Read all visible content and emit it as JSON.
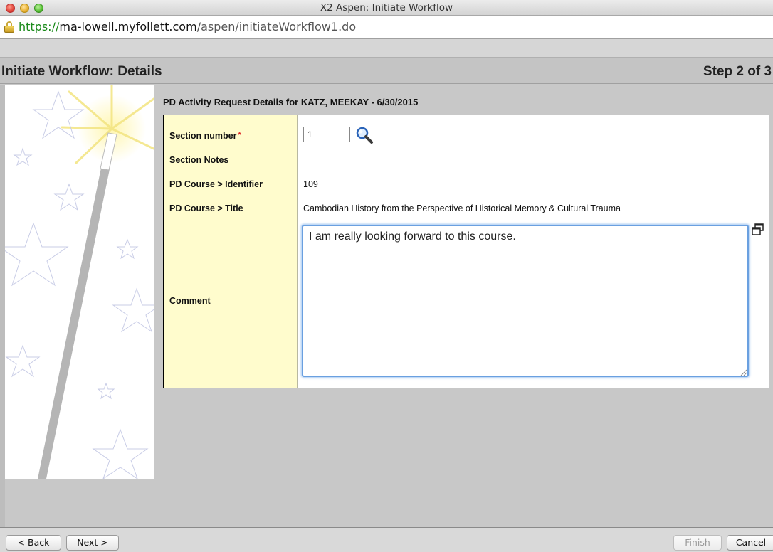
{
  "window": {
    "title": "X2 Aspen: Initiate Workflow"
  },
  "address_bar": {
    "protocol": "https://",
    "host": "ma-lowell.myfollett.com",
    "path": "/aspen/initiateWorkflow1.do"
  },
  "header": {
    "title": "Initiate Workflow: Details",
    "step": "Step 2 of 3"
  },
  "section": {
    "heading": "PD Activity Request Details for KATZ, MEEKAY - 6/30/2015"
  },
  "form": {
    "section_number": {
      "label": "Section number",
      "required_mark": "*",
      "value": "1",
      "lookup_icon": "magnifier-icon"
    },
    "section_notes": {
      "label": "Section Notes",
      "value": ""
    },
    "course_identifier": {
      "label": "PD Course > Identifier",
      "value": "109"
    },
    "course_title": {
      "label": "PD Course > Title",
      "value": "Cambodian History from the Perspective of Historical Memory & Cultural Trauma"
    },
    "comment": {
      "label": "Comment",
      "value": "I am really looking forward to this course."
    }
  },
  "buttons": {
    "back": "< Back",
    "next": "Next >",
    "finish": "Finish",
    "cancel": "Cancel"
  },
  "colors": {
    "label_column": "#fffccd",
    "required": "#dd2222",
    "focus_ring": "#6aa0e0"
  }
}
